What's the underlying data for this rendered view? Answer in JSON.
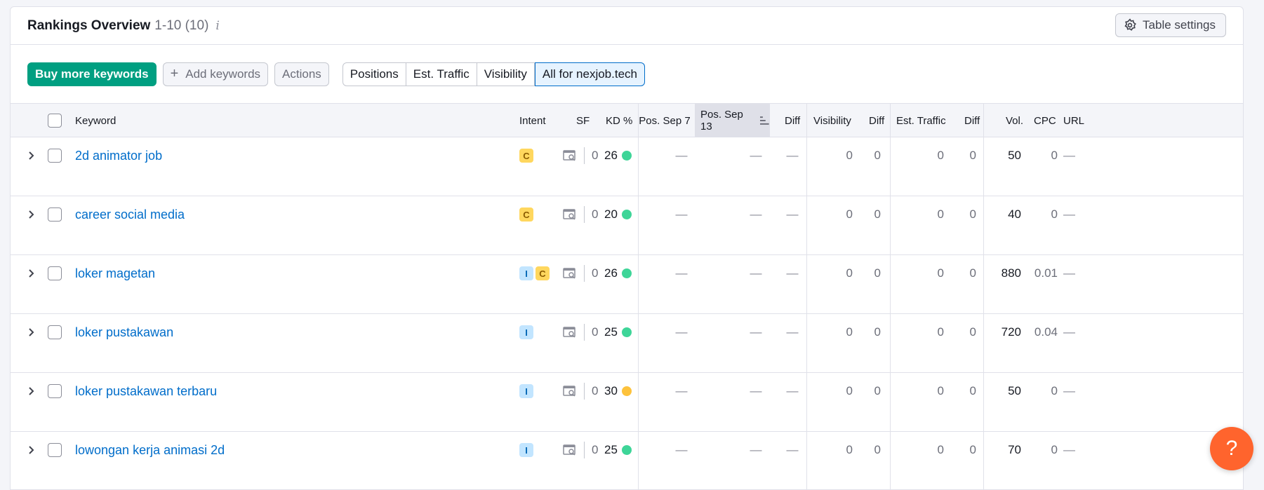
{
  "header": {
    "title": "Rankings Overview",
    "range": "1-10 (10)",
    "info_icon": "i",
    "table_settings_label": "Table settings"
  },
  "toolbar": {
    "buy_label": "Buy more keywords",
    "add_label": "Add keywords",
    "add_icon": "+",
    "actions_label": "Actions",
    "tabs": [
      "Positions",
      "Est. Traffic",
      "Visibility",
      "All for nexjob.tech"
    ],
    "active_tab": "All for nexjob.tech"
  },
  "columns": {
    "keyword": "Keyword",
    "intent": "Intent",
    "sf": "SF",
    "kd": "KD %",
    "pos1": "Pos. Sep 7",
    "pos2": "Pos. Sep 13",
    "diff1": "Diff",
    "visibility": "Visibility",
    "diff2": "Diff",
    "traffic": "Est. Traffic",
    "diff3": "Diff",
    "vol": "Vol.",
    "cpc": "CPC",
    "url": "URL"
  },
  "rows": [
    {
      "keyword": "2d animator job",
      "intent": [
        "C"
      ],
      "sf": "0",
      "kd": "26",
      "kd_color": "#3ed598",
      "pos1": "—",
      "pos2": "—",
      "diff1": "—",
      "visibility": "0",
      "diff2": "0",
      "traffic": "0",
      "diff3": "0",
      "vol": "50",
      "cpc": "0",
      "url": "—"
    },
    {
      "keyword": "career social media",
      "intent": [
        "C"
      ],
      "sf": "0",
      "kd": "20",
      "kd_color": "#3ed598",
      "pos1": "—",
      "pos2": "—",
      "diff1": "—",
      "visibility": "0",
      "diff2": "0",
      "traffic": "0",
      "diff3": "0",
      "vol": "40",
      "cpc": "0",
      "url": "—"
    },
    {
      "keyword": "loker magetan",
      "intent": [
        "I",
        "C"
      ],
      "sf": "0",
      "kd": "26",
      "kd_color": "#3ed598",
      "pos1": "—",
      "pos2": "—",
      "diff1": "—",
      "visibility": "0",
      "diff2": "0",
      "traffic": "0",
      "diff3": "0",
      "vol": "880",
      "cpc": "0.01",
      "url": "—"
    },
    {
      "keyword": "loker pustakawan",
      "intent": [
        "I"
      ],
      "sf": "0",
      "kd": "25",
      "kd_color": "#3ed598",
      "pos1": "—",
      "pos2": "—",
      "diff1": "—",
      "visibility": "0",
      "diff2": "0",
      "traffic": "0",
      "diff3": "0",
      "vol": "720",
      "cpc": "0.04",
      "url": "—"
    },
    {
      "keyword": "loker pustakawan terbaru",
      "intent": [
        "I"
      ],
      "sf": "0",
      "kd": "30",
      "kd_color": "#fdc23c",
      "pos1": "—",
      "pos2": "—",
      "diff1": "—",
      "visibility": "0",
      "diff2": "0",
      "traffic": "0",
      "diff3": "0",
      "vol": "50",
      "cpc": "0",
      "url": "—"
    },
    {
      "keyword": "lowongan kerja animasi 2d",
      "intent": [
        "I"
      ],
      "sf": "0",
      "kd": "25",
      "kd_color": "#3ed598",
      "pos1": "—",
      "pos2": "—",
      "diff1": "—",
      "visibility": "0",
      "diff2": "0",
      "traffic": "0",
      "diff3": "0",
      "vol": "70",
      "cpc": "0",
      "url": "—"
    }
  ],
  "help_label": "?"
}
